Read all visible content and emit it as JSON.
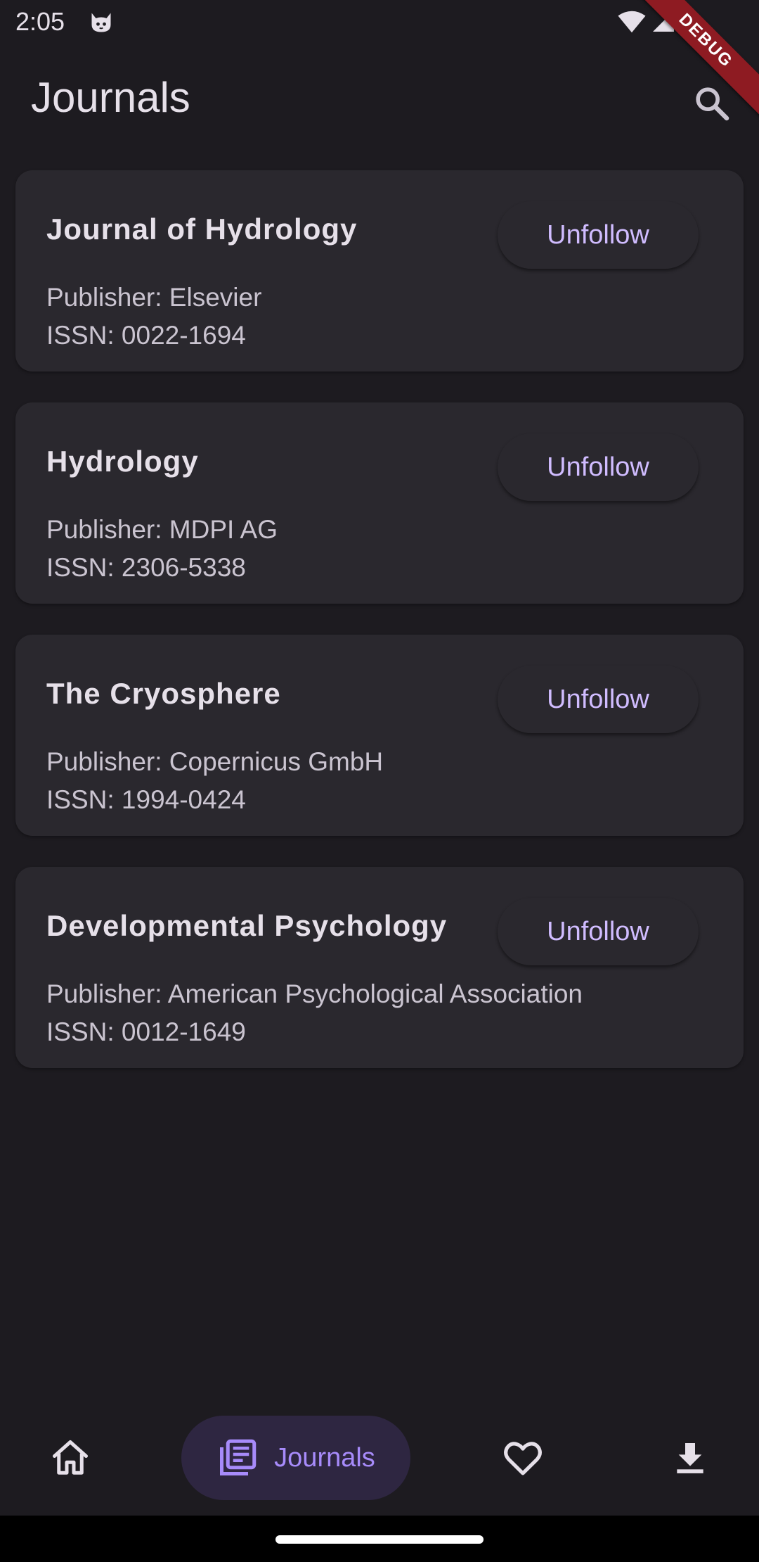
{
  "status_bar": {
    "time": "2:05",
    "debug_label": "DEBUG"
  },
  "header": {
    "title": "Journals"
  },
  "journals": [
    {
      "name": "Journal of Hydrology",
      "publisher": "Publisher: Elsevier",
      "issn": "ISSN: 0022-1694",
      "action_label": "Unfollow"
    },
    {
      "name": "Hydrology",
      "publisher": "Publisher: MDPI AG",
      "issn": "ISSN: 2306-5338",
      "action_label": "Unfollow"
    },
    {
      "name": "The Cryosphere",
      "publisher": "Publisher: Copernicus GmbH",
      "issn": "ISSN: 1994-0424",
      "action_label": "Unfollow"
    },
    {
      "name": "Developmental Psychology",
      "publisher": "Publisher: American Psychological Association",
      "issn": "ISSN: 0012-1649",
      "action_label": "Unfollow"
    }
  ],
  "bottom_nav": {
    "items": [
      {
        "icon": "home-icon",
        "label": ""
      },
      {
        "icon": "journals-icon",
        "label": "Journals",
        "selected": true
      },
      {
        "icon": "heart-icon",
        "label": ""
      },
      {
        "icon": "download-icon",
        "label": ""
      }
    ]
  },
  "colors": {
    "background": "#1d1b20",
    "card": "#2a282e",
    "accent": "#d0bcff",
    "nav_selected": "#a78bfa",
    "debug_ribbon": "#8e1b22"
  }
}
